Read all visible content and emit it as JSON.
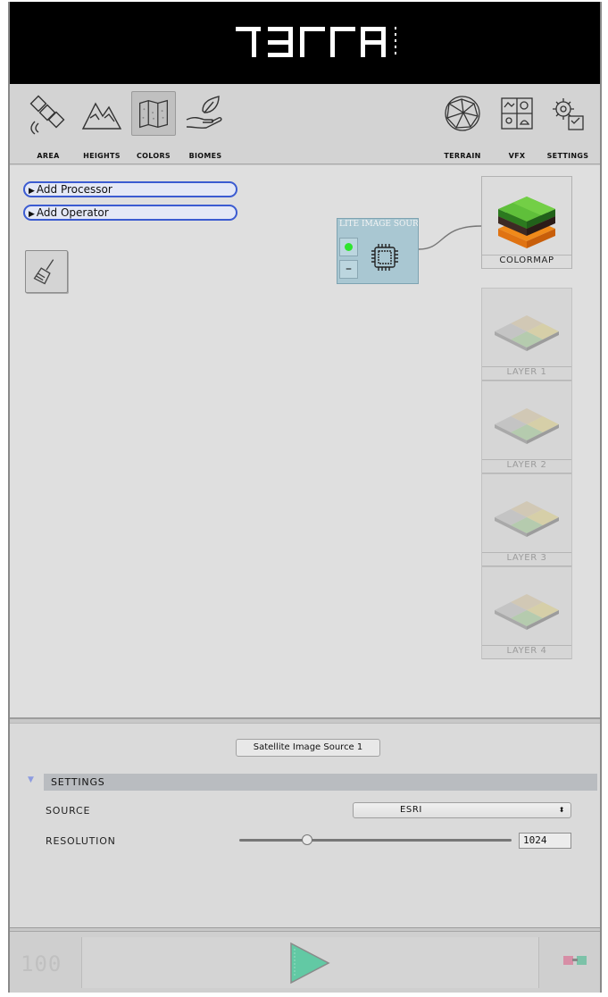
{
  "app": {
    "brand": "TERRA"
  },
  "tabs": {
    "left": [
      {
        "label": "AREA",
        "icon": "satellite-icon"
      },
      {
        "label": "HEIGHTS",
        "icon": "mountains-icon"
      },
      {
        "label": "COLORS",
        "icon": "map-icon",
        "active": true
      },
      {
        "label": "BIOMES",
        "icon": "leaf-hand-icon"
      }
    ],
    "right": [
      {
        "label": "TERRAIN",
        "icon": "globe-mesh-icon"
      },
      {
        "label": "VFX",
        "icon": "vfx-grid-icon"
      },
      {
        "label": "SETTINGS",
        "icon": "gears-icon"
      }
    ]
  },
  "graph": {
    "add_processor": "Add Processor",
    "add_operator": "Add Operator",
    "node": {
      "title": "LITE IMAGE SOUR",
      "minus": "–"
    },
    "outputs": {
      "colormap": "COLORMAP",
      "layers": [
        "LAYER 1",
        "LAYER 2",
        "LAYER 3",
        "LAYER 4"
      ]
    }
  },
  "inspector": {
    "node_name": "Satellite Image Source 1",
    "section_title": "SETTINGS",
    "source_label": "SOURCE",
    "source_value": "ESRI",
    "resolution_label": "RESOLUTION",
    "resolution_value": "1024",
    "resolution_fraction": 0.25
  },
  "bottom": {
    "counter": "100"
  },
  "colors": {
    "header_bg": "#000000",
    "accent_blue": "#3b5bd1",
    "node_bg": "#a9c7d2",
    "play_green": "#5cc7a0"
  }
}
